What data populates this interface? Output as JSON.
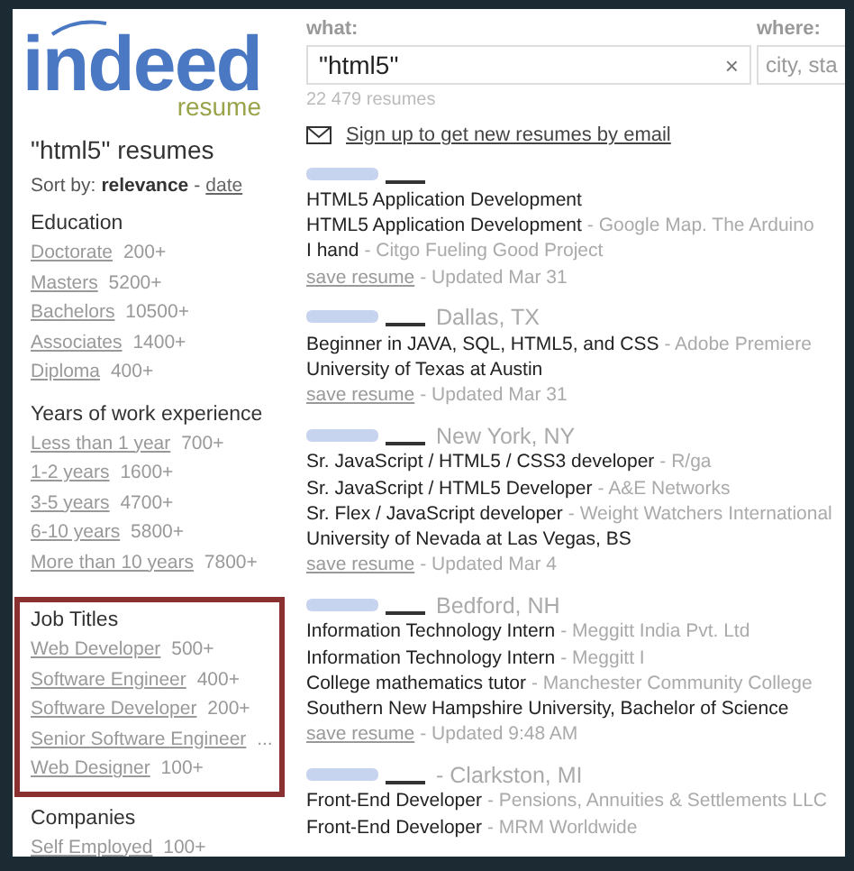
{
  "logo": {
    "brand": "indeed",
    "sub": "resume"
  },
  "search": {
    "what_label": "what:",
    "what_value": "\"html5\"",
    "clear": "×",
    "where_label": "where:",
    "where_placeholder": "city, sta",
    "count": "22 479 resumes"
  },
  "heading": "\"html5\" resumes",
  "sort": {
    "label": "Sort by:",
    "separator": "-",
    "options": [
      {
        "text": "relevance",
        "selected": true
      },
      {
        "text": "date",
        "selected": false
      }
    ]
  },
  "facets": [
    {
      "title": "Education",
      "highlighted": false,
      "items": [
        {
          "label": "Doctorate",
          "count": "200+"
        },
        {
          "label": "Masters",
          "count": "5200+"
        },
        {
          "label": "Bachelors",
          "count": "10500+"
        },
        {
          "label": "Associates",
          "count": "1400+"
        },
        {
          "label": "Diploma",
          "count": "400+"
        }
      ]
    },
    {
      "title": "Years of work experience",
      "highlighted": false,
      "items": [
        {
          "label": "Less than 1 year",
          "count": "700+"
        },
        {
          "label": "1-2 years",
          "count": "1600+"
        },
        {
          "label": "3-5 years",
          "count": "4700+"
        },
        {
          "label": "6-10 years",
          "count": "5800+"
        },
        {
          "label": "More than 10 years",
          "count": "7800+"
        }
      ]
    },
    {
      "title": "Job Titles",
      "highlighted": true,
      "items": [
        {
          "label": "Web Developer",
          "count": "500+"
        },
        {
          "label": "Software Engineer",
          "count": "400+"
        },
        {
          "label": "Software Developer",
          "count": "200+"
        },
        {
          "label": "Senior Software Engineer",
          "count": "..."
        },
        {
          "label": "Web Designer",
          "count": "100+"
        }
      ]
    },
    {
      "title": "Companies",
      "highlighted": false,
      "items": [
        {
          "label": "Self Employed",
          "count": "100+"
        }
      ]
    }
  ],
  "email_link": "Sign up to get new resumes by email",
  "results": [
    {
      "entries": [
        {
          "title": "HTML5 Application Development"
        },
        {
          "title": "HTML5 Application Development",
          "company": "- Google Map. The Arduino"
        },
        {
          "title": "I hand",
          "company": "- Citgo Fueling Good Project"
        }
      ],
      "save": "save resume",
      "updated": "- Updated  Mar 31"
    },
    {
      "location": "Dallas, TX",
      "entries": [
        {
          "title": "Beginner in JAVA, SQL, HTML5, and CSS",
          "company": "- Adobe Premiere"
        }
      ],
      "education": "University of Texas at Austin",
      "save": "save resume",
      "updated": "- Updated  Mar 31"
    },
    {
      "location": "New York, NY",
      "entries": [
        {
          "title": "Sr. JavaScript / HTML5 / CSS3 developer",
          "company": "- R/ga"
        },
        {
          "title": "Sr. JavaScript / HTML5 Developer",
          "company": "- A&E Networks"
        },
        {
          "title": "Sr. Flex / JavaScript developer",
          "company": "- Weight Watchers International"
        }
      ],
      "education": "University of Nevada at Las Vegas, BS",
      "save": "save resume",
      "updated": "- Updated  Mar 4"
    },
    {
      "location": "Bedford, NH",
      "entries": [
        {
          "title": "Information Technology Intern",
          "company": "- Meggitt India Pvt. Ltd"
        },
        {
          "title": "Information Technology Intern",
          "company": "- Meggitt I"
        },
        {
          "title": "College mathematics tutor",
          "company": "- Manchester Community College"
        }
      ],
      "education": "Southern New Hampshire University, Bachelor of Science",
      "save": "save resume",
      "updated": "- Updated  9:48 AM"
    },
    {
      "location": "- Clarkston, MI",
      "entries": [
        {
          "title": "Front-End Developer",
          "company": "- Pensions, Annuities & Settlements LLC"
        },
        {
          "title": "Front-End Developer",
          "company": "- MRM Worldwide"
        }
      ]
    }
  ]
}
